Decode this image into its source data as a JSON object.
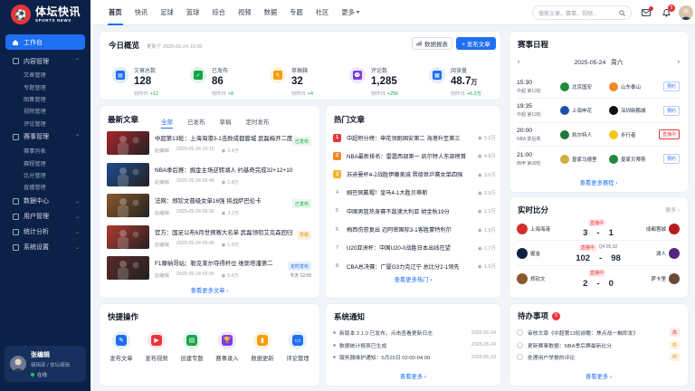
{
  "logo": {
    "badge": "⚽",
    "main": "体坛快讯",
    "sub": "SPORTS NEWS"
  },
  "sidebar": {
    "active": "工作台",
    "groups": [
      {
        "label": "内容管理",
        "subs": [
          "文章管理",
          "专题管理",
          "图集管理",
          "视频管理",
          "评论管理"
        ]
      },
      {
        "label": "赛事管理",
        "subs": [
          "赛事列表",
          "赛程管理",
          "比分管理",
          "直播管理"
        ]
      },
      {
        "label": "数据中心",
        "subs": []
      },
      {
        "label": "用户管理",
        "subs": []
      },
      {
        "label": "统计分析",
        "subs": []
      },
      {
        "label": "系统设置",
        "subs": []
      }
    ],
    "user": {
      "name": "张编辑",
      "role": "编辑部 / 体坛编辑",
      "status": "在线"
    }
  },
  "topbar": {
    "nav": [
      "首页",
      "快讯",
      "足球",
      "篮球",
      "综合",
      "视频",
      "数据",
      "专题",
      "社区",
      "更多"
    ],
    "more_suffix": "▾",
    "search_placeholder": "搜索文章、赛事、视频...",
    "mail_badge": "",
    "bell_badge": "5"
  },
  "overview": {
    "title": "今日概览",
    "updated": "更新于 2025-05-24 10:30",
    "report_btn": "数据报表",
    "publish_btn": "+ 发布文章",
    "stats": [
      {
        "label": "文章总数",
        "value": "128",
        "unit": "",
        "delta_label": "较昨日",
        "delta": "+12",
        "color": "#1e6ff1"
      },
      {
        "label": "已发布",
        "value": "86",
        "unit": "",
        "delta_label": "较昨日",
        "delta": "+8",
        "color": "#16a34a"
      },
      {
        "label": "草稿箱",
        "value": "32",
        "unit": "",
        "delta_label": "较昨日",
        "delta": "+4",
        "color": "#f59e0b"
      },
      {
        "label": "评论数",
        "value": "1,285",
        "unit": "",
        "delta_label": "较昨日",
        "delta": "+256",
        "color": "#7c3aed"
      },
      {
        "label": "阅读量",
        "value": "48.7",
        "unit": "万",
        "delta_label": "较昨日",
        "delta": "+6.3万",
        "color": "#1e6ff1"
      }
    ]
  },
  "latest": {
    "title": "最新文章",
    "tabs": [
      "全部",
      "已发布",
      "草稿",
      "定时发布"
    ],
    "items": [
      {
        "title": "中超第13轮：上海海港3-1击败成都蓉城 武磊梅开二度",
        "author": "赵编辑",
        "time": "2025-05-24 10:15",
        "views": "2.4万",
        "tag": "已发布",
        "tag_type": "green",
        "thumb": "#a8262c"
      },
      {
        "title": "NBA季后赛：掘金主场逆转湖人 约基奇完成32+12+10",
        "author": "赵编辑",
        "time": "2025-05-24 09:48",
        "views": "1.8万",
        "tag": "",
        "tag_type": "",
        "thumb": "#1f4c8f"
      },
      {
        "title": "法网：郑钦文晋级女单16强 将战萨巴伦卡",
        "author": "赵编辑",
        "time": "2025-05-24 09:30",
        "views": "3.2万",
        "tag": "已发布",
        "tag_type": "green",
        "thumb": "#8a5a2a"
      },
      {
        "title": "官方：国足公布6月世预赛大名单 武磊领衔艾克森回归",
        "author": "赵编辑",
        "time": "2025-05-24 09:45",
        "views": "1.5万",
        "tag": "草稿",
        "tag_type": "orange",
        "thumb": "#b23a2f"
      },
      {
        "title": "F1摩纳哥站：勒克莱尔夺得杆位 维斯塔潘第二",
        "author": "赵编辑",
        "time": "2025-05-24 09:00",
        "views": "5.6万",
        "tag": "定时发布",
        "tag_type": "blue",
        "sched": "今天 12:00",
        "thumb": "#5b2a2a"
      }
    ],
    "more": "查看更多文章"
  },
  "hot": {
    "title": "热门文章",
    "items": [
      {
        "rank": "1",
        "title": "中超积分榜：申花领跑国安第二 海港升至第三",
        "heat": "5.2万"
      },
      {
        "rank": "2",
        "title": "NBA最新排名：雷霆西部第一 凯尔特人东部榜首",
        "heat": "4.8万"
      },
      {
        "rank": "3",
        "title": "苏迪曼杯4-2战胜伊藤美诚 晋级世乒赛女单四强",
        "heat": "3.6万"
      },
      {
        "rank": "4",
        "title": "姆巴佩戴帽！皇马4-1大胜贝蒂斯",
        "heat": "2.9万"
      },
      {
        "rank": "5",
        "title": "中国男篮热身赛不敌澳大利亚 胡金秋19分",
        "heat": "2.3万"
      },
      {
        "rank": "6",
        "title": "梅西伤愈复出 迈阿密国际3-1客胜蒙特利尔",
        "heat": "1.9万"
      },
      {
        "rank": "7",
        "title": "U20亚洲杯：中国U20-0战胜日本出线在望",
        "heat": "1.7万"
      },
      {
        "rank": "8",
        "title": "CBA总决赛：广厦G3力克辽宁 总比分2-1领先",
        "heat": "1.5万"
      }
    ],
    "more": "查看更多热门"
  },
  "schedule": {
    "title": "赛事日程",
    "date": "2025-05-24",
    "weekday": "周六",
    "rows": [
      {
        "time": "15:30",
        "league": "中超 第13轮",
        "home": "北京国安",
        "away": "山东泰山",
        "status": "预约",
        "state": "blue",
        "hc": "#1f8a3b",
        "ac": "#f08a24"
      },
      {
        "time": "19:35",
        "league": "中超 第13轮",
        "home": "上海申花",
        "away": "深圳新鹏城",
        "status": "预约",
        "state": "blue",
        "hc": "#1e4fa8",
        "ac": "#101010"
      },
      {
        "time": "20:00",
        "league": "NBA 季后赛",
        "home": "凯尔特人",
        "away": "步行者",
        "status": "直播中",
        "state": "red",
        "hc": "#1f7a3b",
        "ac": "#f5c518"
      },
      {
        "time": "21:00",
        "league": "西甲 第38轮",
        "home": "皇家马德里",
        "away": "皇家贝蒂斯",
        "status": "预约",
        "state": "blue",
        "hc": "#d1ad3c",
        "ac": "#1f8a3b"
      }
    ],
    "more": "查看更多赛程"
  },
  "live": {
    "title": "实时比分",
    "more": "更多",
    "rows": [
      {
        "home": "上海海港",
        "away": "成都蓉城",
        "state": "直播中",
        "minute": "",
        "score_h": "3",
        "score_a": "1",
        "hc": "#d32f2f",
        "ac": "#b71c1c"
      },
      {
        "home": "掘金",
        "away": "湖人",
        "state": "直播中",
        "minute": "Q4 05:32",
        "score_h": "102",
        "score_a": "98",
        "hc": "#0e2240",
        "ac": "#552583"
      },
      {
        "home": "郑钦文",
        "away": "萨卡里",
        "state": "直播中",
        "minute": "",
        "score_h": "2",
        "score_a": "0",
        "hc": "#8b5a2b",
        "ac": "#6b4a3a"
      }
    ]
  },
  "quick": {
    "title": "快捷操作",
    "items": [
      {
        "label": "发布文章",
        "color": "#1e6ff1",
        "bg": "#e7effd",
        "icon": "✎"
      },
      {
        "label": "发布视频",
        "color": "#e8343a",
        "bg": "#fde8e8",
        "icon": "▶"
      },
      {
        "label": "创建专题",
        "color": "#16a34a",
        "bg": "#e4f6ea",
        "icon": "▤"
      },
      {
        "label": "赛事录入",
        "color": "#7c3aed",
        "bg": "#efe7fd",
        "icon": "🏆"
      },
      {
        "label": "数据更新",
        "color": "#f59e0b",
        "bg": "#fef3e0",
        "icon": "▮"
      },
      {
        "label": "评论管理",
        "color": "#1e6ff1",
        "bg": "#e7effd",
        "icon": "▭"
      }
    ]
  },
  "notices": {
    "title": "系统通知",
    "items": [
      {
        "text": "新版本 2.1.0 已发布，点击查看更新日志",
        "date": "2025-05-24"
      },
      {
        "text": "数据统计报表已生成",
        "date": "2025-05-24"
      },
      {
        "text": "服务器维护通知：5月25日 02:00-04:00",
        "date": "2025-05-23"
      }
    ],
    "more": "查看更多"
  },
  "todos": {
    "title": "待办事项",
    "badge": "5",
    "items": [
      {
        "text": "审核文章《中超第13轮前瞻：焦点战一触即发》",
        "prio": "高",
        "color": "#e8343a",
        "bg": "#fde8e8"
      },
      {
        "text": "更新赛事数据：NBA季后赛最新比分",
        "prio": "中",
        "color": "#ea8a14",
        "bg": "#fff1e0"
      },
      {
        "text": "处理用户举报的评论",
        "prio": "中",
        "color": "#ea8a14",
        "bg": "#fff1e0"
      }
    ],
    "more": "查看更多"
  }
}
